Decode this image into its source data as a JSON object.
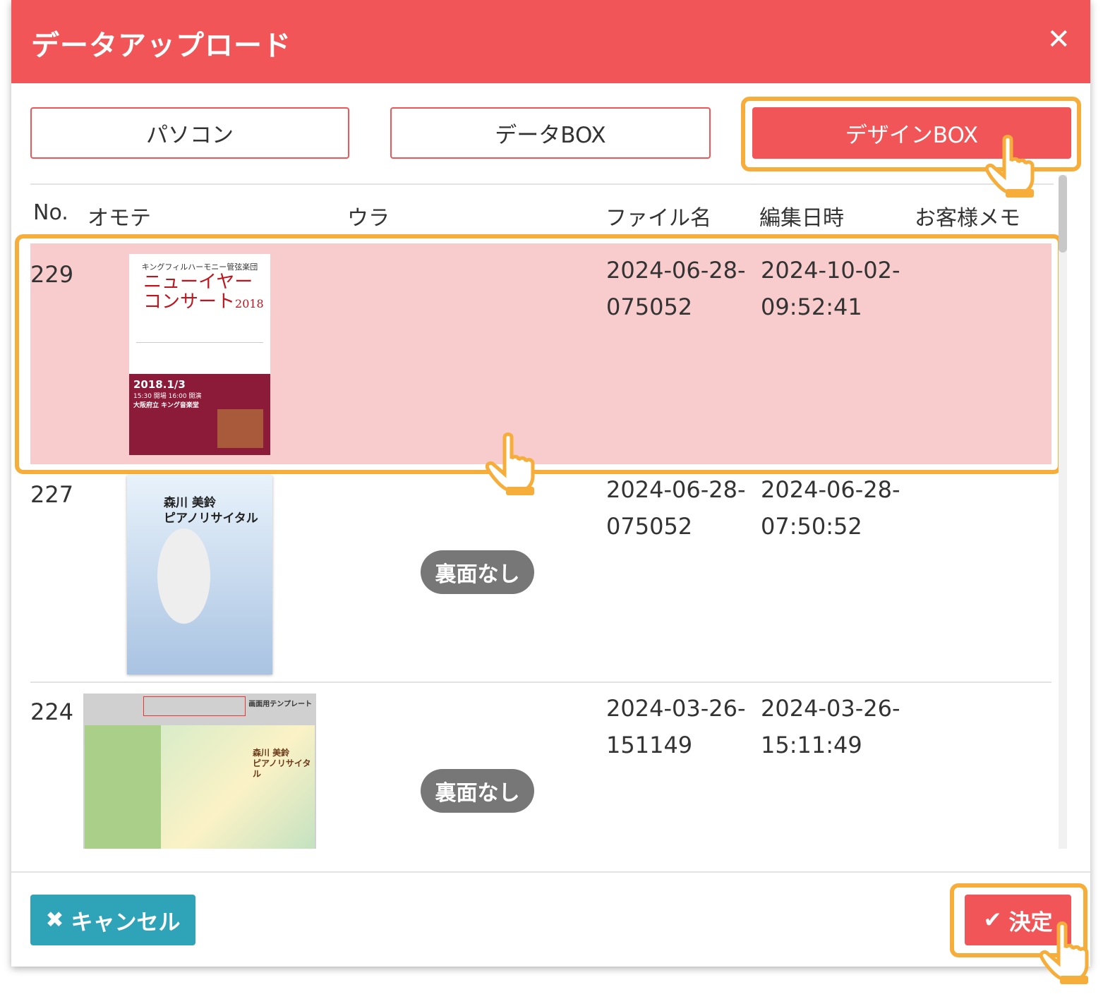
{
  "dialog": {
    "title": "データアップロード",
    "close_icon": "close-icon"
  },
  "sources": {
    "pc": "パソコン",
    "databox": "データBOX",
    "designbox": "デザインBOX",
    "active": "designbox"
  },
  "columns": {
    "no": "No.",
    "front": "オモテ",
    "back": "ウラ",
    "filename": "ファイル名",
    "edited": "編集日時",
    "memo": "お客様メモ"
  },
  "rows": [
    {
      "no": "229",
      "filename_1": "2024-06-28-",
      "filename_2": "075052",
      "edited_1": "2024-10-02-",
      "edited_2": "09:52:41",
      "back": "",
      "selected": true,
      "front_thumb": {
        "org": "キングフィルハーモニー管弦楽団",
        "title_1": "ニューイヤー",
        "title_2": "コンサート",
        "year": "2018",
        "date": "2018.1/3",
        "time": "15:30 開場 16:00 開演",
        "venue": "大阪府立 キング音楽堂"
      }
    },
    {
      "no": "227",
      "filename_1": "2024-06-28-",
      "filename_2": "075052",
      "edited_1": "2024-06-28-",
      "edited_2": "07:50:52",
      "back": "裏面なし",
      "selected": false,
      "front_thumb": {
        "title_1": "森川 美鈴",
        "title_2": "ピアノリサイタル"
      }
    },
    {
      "no": "224",
      "filename_1": "2024-03-26-",
      "filename_2": "151149",
      "edited_1": "2024-03-26-",
      "edited_2": "15:11:49",
      "back": "裏面なし",
      "selected": false,
      "front_thumb": {
        "title_1": "森川 美鈴",
        "title_2": "ピアノリサイタル",
        "header": "画面用テンプレート"
      }
    }
  ],
  "footer": {
    "cancel": "キャンセル",
    "confirm": "決定"
  },
  "colors": {
    "primary": "#f25557",
    "highlight": "#f6ad3a",
    "selected_row": "#f8cccc",
    "cancel": "#2fa3b8",
    "badge": "#777777"
  }
}
